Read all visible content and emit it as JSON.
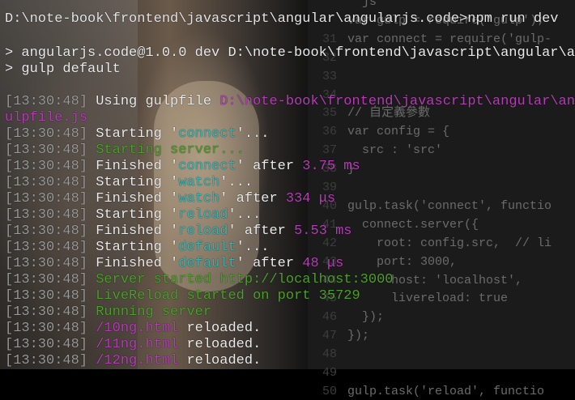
{
  "editor": {
    "lines": [
      {
        "num": "",
        "text": "  js"
      },
      {
        "num": "",
        "text": "var gulp = require('gulp');"
      },
      {
        "num": "31",
        "text": "var connect = require('gulp-"
      },
      {
        "num": "32",
        "text": ""
      },
      {
        "num": "33",
        "text": ""
      },
      {
        "num": "34",
        "text": ""
      },
      {
        "num": "35",
        "text": "// 自定義參數"
      },
      {
        "num": "36",
        "text": "var config = {"
      },
      {
        "num": "37",
        "text": "  src : 'src'"
      },
      {
        "num": "38",
        "text": "}"
      },
      {
        "num": "39",
        "text": ""
      },
      {
        "num": "40",
        "text": "gulp.task('connect', functio"
      },
      {
        "num": "41",
        "text": "  connect.server({"
      },
      {
        "num": "42",
        "text": "    root: config.src,  // li"
      },
      {
        "num": "43",
        "text": "    port: 3000,"
      },
      {
        "num": "44",
        "text": "      host: 'localhost',"
      },
      {
        "num": "45",
        "text": "      livereload: true"
      },
      {
        "num": "46",
        "text": "  });"
      },
      {
        "num": "47",
        "text": "});"
      },
      {
        "num": "48",
        "text": ""
      },
      {
        "num": "49",
        "text": ""
      },
      {
        "num": "50",
        "text": "gulp.task('reload', functio"
      }
    ]
  },
  "terminal": {
    "prompt_cmd": "D:\\note-book\\frontend\\javascript\\angular\\angularjs.code>npm run dev",
    "lines": [
      {
        "ts": "",
        "parts": [
          {
            "t": "> angularjs.code@1.0.0 dev D:\\note-book\\frontend\\javascript\\angular\\ang",
            "c": "white"
          }
        ]
      },
      {
        "ts": "",
        "parts": [
          {
            "t": "> gulp default",
            "c": "white"
          }
        ]
      },
      {
        "ts": "",
        "parts": []
      },
      {
        "ts": "[13:30:48]",
        "parts": [
          {
            "t": " Using gulpfile ",
            "c": "white"
          },
          {
            "t": "D:\\note-book\\frontend\\javascript\\angular\\ang",
            "c": "magenta"
          }
        ]
      },
      {
        "ts": "",
        "parts": [
          {
            "t": "ulpfile.js",
            "c": "magenta"
          }
        ]
      },
      {
        "ts": "[13:30:48]",
        "parts": [
          {
            "t": " Starting '",
            "c": "white"
          },
          {
            "t": "connect",
            "c": "cyan"
          },
          {
            "t": "'...",
            "c": "white"
          }
        ]
      },
      {
        "ts": "[13:30:48]",
        "parts": [
          {
            "t": " Starting server...",
            "c": "green"
          }
        ]
      },
      {
        "ts": "[13:30:48]",
        "parts": [
          {
            "t": " Finished '",
            "c": "white"
          },
          {
            "t": "connect",
            "c": "cyan"
          },
          {
            "t": "' after ",
            "c": "white"
          },
          {
            "t": "3.75 ms",
            "c": "magenta"
          }
        ]
      },
      {
        "ts": "[13:30:48]",
        "parts": [
          {
            "t": " Starting '",
            "c": "white"
          },
          {
            "t": "watch",
            "c": "cyan"
          },
          {
            "t": "'...",
            "c": "white"
          }
        ]
      },
      {
        "ts": "[13:30:48]",
        "parts": [
          {
            "t": " Finished '",
            "c": "white"
          },
          {
            "t": "watch",
            "c": "cyan"
          },
          {
            "t": "' after ",
            "c": "white"
          },
          {
            "t": "334 μs",
            "c": "magenta"
          }
        ]
      },
      {
        "ts": "[13:30:48]",
        "parts": [
          {
            "t": " Starting '",
            "c": "white"
          },
          {
            "t": "reload",
            "c": "cyan"
          },
          {
            "t": "'...",
            "c": "white"
          }
        ]
      },
      {
        "ts": "[13:30:48]",
        "parts": [
          {
            "t": " Finished '",
            "c": "white"
          },
          {
            "t": "reload",
            "c": "cyan"
          },
          {
            "t": "' after ",
            "c": "white"
          },
          {
            "t": "5.53 ms",
            "c": "magenta"
          }
        ]
      },
      {
        "ts": "[13:30:48]",
        "parts": [
          {
            "t": " Starting '",
            "c": "white"
          },
          {
            "t": "default",
            "c": "cyan"
          },
          {
            "t": "'...",
            "c": "white"
          }
        ]
      },
      {
        "ts": "[13:30:48]",
        "parts": [
          {
            "t": " Finished '",
            "c": "white"
          },
          {
            "t": "default",
            "c": "cyan"
          },
          {
            "t": "' after ",
            "c": "white"
          },
          {
            "t": "48 μs",
            "c": "magenta"
          }
        ]
      },
      {
        "ts": "[13:30:48]",
        "parts": [
          {
            "t": " Server started http://localhost:3000",
            "c": "green"
          }
        ]
      },
      {
        "ts": "[13:30:48]",
        "parts": [
          {
            "t": " LiveReload started on port 35729",
            "c": "green"
          }
        ]
      },
      {
        "ts": "[13:30:48]",
        "parts": [
          {
            "t": " Running server",
            "c": "green"
          }
        ]
      },
      {
        "ts": "[13:30:48]",
        "parts": [
          {
            "t": " /10ng.html",
            "c": "magenta"
          },
          {
            "t": " reloaded.",
            "c": "white"
          }
        ]
      },
      {
        "ts": "[13:30:48]",
        "parts": [
          {
            "t": " /11ng.html",
            "c": "magenta"
          },
          {
            "t": " reloaded.",
            "c": "white"
          }
        ]
      },
      {
        "ts": "[13:30:48]",
        "parts": [
          {
            "t": " /12ng.html",
            "c": "magenta"
          },
          {
            "t": " reloaded.",
            "c": "white"
          }
        ]
      }
    ]
  },
  "colors": {
    "white": "#ececec",
    "cyan": "#3fb4b4",
    "green": "#4f9f30",
    "magenta": "#b43fb4",
    "gray": "#9a9a9a"
  }
}
